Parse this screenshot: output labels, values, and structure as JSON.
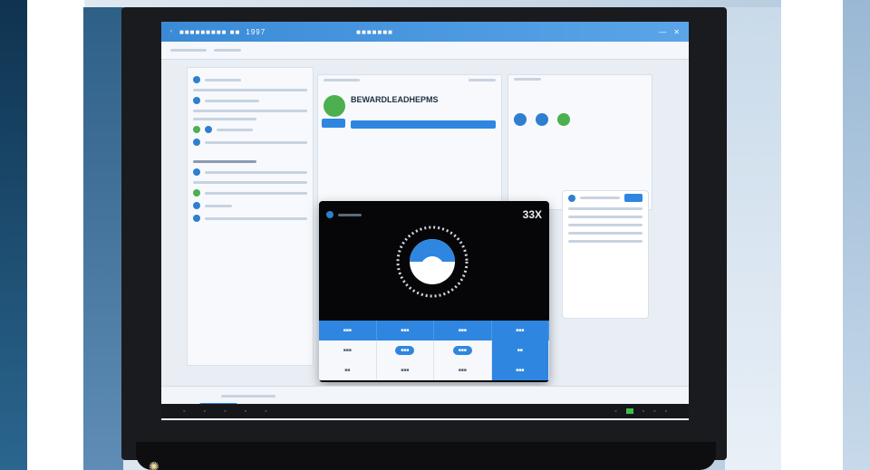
{
  "window": {
    "title_text": "1997",
    "close_glyph": "✕",
    "minimize_glyph": "—"
  },
  "panel_mid": {
    "title": "BEWARDLEADHEPMS"
  },
  "dialog": {
    "close_label": "33X"
  },
  "colors": {
    "accent": "#2f86e0",
    "success": "#4caf50",
    "titlebar": "#3a8ad6",
    "dialog_bg": "#060608"
  },
  "icons": {
    "window_close": "close-icon",
    "spinner": "loading-spinner-icon",
    "taskbar_tray": "tray-icon"
  }
}
